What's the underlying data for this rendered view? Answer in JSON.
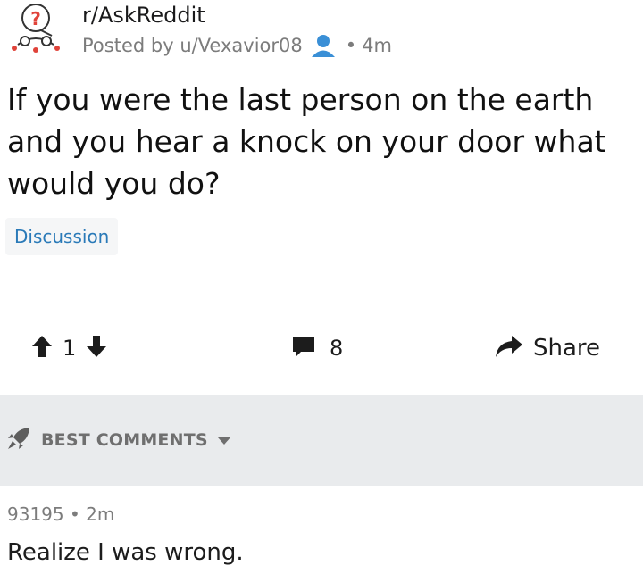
{
  "post": {
    "subreddit": "r/AskReddit",
    "posted_by_prefix": "Posted by",
    "author": "u/Vexavior08",
    "age": "4m",
    "title": "If you were the last person on the earth and you hear a knock on your door what would you do?",
    "flair": "Discussion"
  },
  "actions": {
    "vote_count": "1",
    "comment_count": "8",
    "share_label": "Share"
  },
  "sort": {
    "label": "BEST COMMENTS"
  },
  "comment": {
    "score": "93195",
    "age": "2m",
    "body": "Realize I was wrong."
  },
  "icons": {
    "subreddit": "askreddit-snoo-icon",
    "user": "user-icon",
    "upvote": "up-arrow-icon",
    "downvote": "down-arrow-icon",
    "comments": "comment-bubble-icon",
    "share": "share-arrow-icon",
    "sort": "rocket-icon",
    "sort_caret": "caret-down-icon"
  },
  "colors": {
    "flair_text": "#2a7ab8",
    "user_icon": "#3a8fd6",
    "sort_bar": "#e9ebed",
    "muted_text": "#7c7c7c"
  }
}
